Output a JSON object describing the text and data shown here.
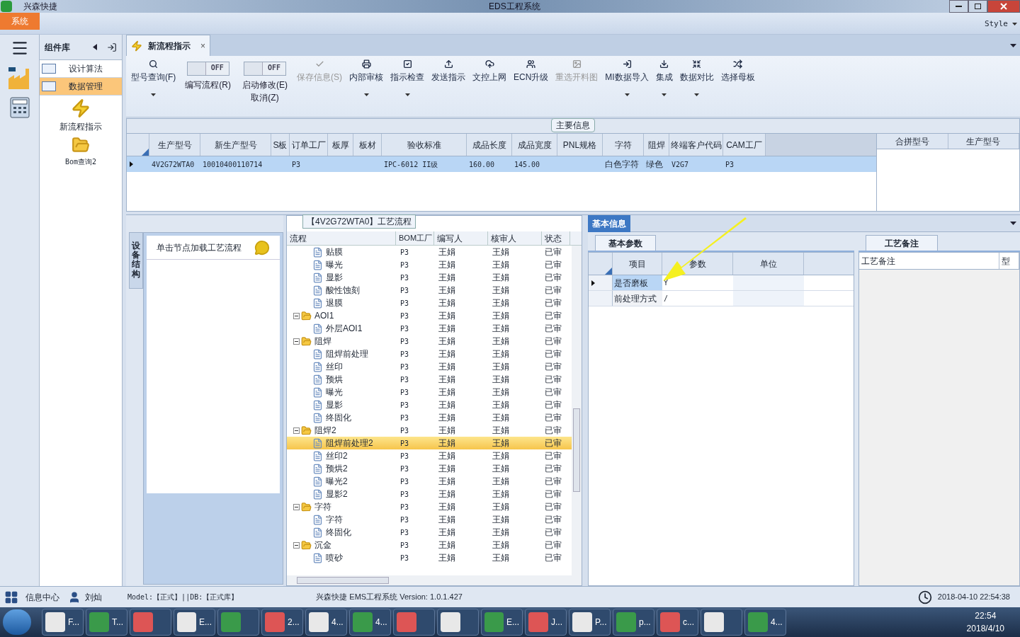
{
  "window": {
    "app_name": "兴森快捷",
    "title": "EDS工程系统"
  },
  "menu": [
    {
      "label": "系统",
      "selected": true
    }
  ],
  "style_menu": "Style",
  "nav": {
    "title": "组件库",
    "items": [
      {
        "label": "设计算法",
        "selected": false
      },
      {
        "label": "数据管理",
        "selected": true
      }
    ],
    "tools": [
      {
        "label": "新流程指示"
      },
      {
        "label": "Bom查询2"
      }
    ]
  },
  "doc_tab": {
    "label": "新流程指示",
    "close": "×"
  },
  "toolbar": [
    {
      "kind": "button",
      "label": "型号查询(F)",
      "disabled": false,
      "dropdown": true
    },
    {
      "kind": "toggle",
      "label": "编写流程(R)",
      "state": "OFF",
      "on": false
    },
    {
      "kind": "toggle",
      "label": "启动修改(E)",
      "sublabel": "取消(Z)",
      "state": "OFF",
      "on": false
    },
    {
      "kind": "button",
      "label": "保存信息(S)",
      "disabled": true,
      "dropdown": false
    },
    {
      "kind": "button",
      "label": "内部审核",
      "disabled": false,
      "dropdown": true
    },
    {
      "kind": "button",
      "label": "指示检查",
      "disabled": false,
      "dropdown": true
    },
    {
      "kind": "button",
      "label": "发送指示",
      "disabled": false,
      "dropdown": false
    },
    {
      "kind": "button",
      "label": "文控上网",
      "disabled": false,
      "dropdown": false
    },
    {
      "kind": "button",
      "label": "ECN升级",
      "disabled": false,
      "dropdown": false
    },
    {
      "kind": "button",
      "label": "重选开料图",
      "disabled": true,
      "dropdown": false
    },
    {
      "kind": "button",
      "label": "MI数据导入",
      "disabled": false,
      "dropdown": true
    },
    {
      "kind": "button",
      "label": "集成",
      "disabled": false,
      "dropdown": true
    },
    {
      "kind": "button",
      "label": "数据对比",
      "disabled": false,
      "dropdown": true
    },
    {
      "kind": "button",
      "label": "选择母板",
      "disabled": false,
      "dropdown": false
    }
  ],
  "main_info": {
    "title": "主要信息",
    "columns": [
      "生产型号",
      "新生产型号",
      "S板",
      "订单工厂",
      "板厚",
      "板材",
      "验收标准",
      "成品长度",
      "成品宽度",
      "PNL规格",
      "字符",
      "阻焊",
      "终端客户代码",
      "CAM工厂"
    ],
    "rows": [
      {
        "selected": true,
        "cells": [
          "4V2G72WTA0",
          "10010400110714",
          "",
          "P3",
          "",
          "",
          "IPC-6012 II级",
          "160.00",
          "145.00",
          "",
          "白色字符",
          "绿色",
          "V2G7",
          "P3"
        ]
      }
    ],
    "side_columns": [
      "合拼型号",
      "生产型号"
    ]
  },
  "structure": {
    "tab": "设备结构",
    "node_hint": "单击节点加载工艺流程"
  },
  "process": {
    "title": "【4V2G72WTA0】工艺流程",
    "columns": [
      "流程",
      "BOM工厂",
      "编写人",
      "核审人",
      "状态"
    ],
    "rows": [
      {
        "kind": "hidden",
        "children": [
          {
            "kind": "file",
            "label": "贴膜",
            "bom": "P3",
            "writer": "王娟",
            "reviewer": "王娟",
            "status": "已审",
            "selected": false
          },
          {
            "kind": "file",
            "label": "曝光",
            "bom": "P3",
            "writer": "王娟",
            "reviewer": "王娟",
            "status": "已审",
            "selected": false
          },
          {
            "kind": "file",
            "label": "显影",
            "bom": "P3",
            "writer": "王娟",
            "reviewer": "王娟",
            "status": "已审",
            "selected": false
          },
          {
            "kind": "file",
            "label": "酸性蚀刻",
            "bom": "P3",
            "writer": "王娟",
            "reviewer": "王娟",
            "status": "已审",
            "selected": false
          },
          {
            "kind": "file",
            "label": "退膜",
            "bom": "P3",
            "writer": "王娟",
            "reviewer": "王娟",
            "status": "已审",
            "selected": false
          }
        ]
      },
      {
        "kind": "folder",
        "label": "AOI1",
        "bom": "P3",
        "writer": "王娟",
        "reviewer": "王娟",
        "status": "已审",
        "selected": false,
        "expanded": true,
        "children": [
          {
            "kind": "file",
            "label": "外层AOI1",
            "bom": "P3",
            "writer": "王娟",
            "reviewer": "王娟",
            "status": "已审",
            "selected": false
          }
        ]
      },
      {
        "kind": "folder",
        "label": "阻焊",
        "bom": "P3",
        "writer": "王娟",
        "reviewer": "王娟",
        "status": "已审",
        "selected": false,
        "expanded": true,
        "children": [
          {
            "kind": "file",
            "label": "阻焊前处理",
            "bom": "P3",
            "writer": "王娟",
            "reviewer": "王娟",
            "status": "已审",
            "selected": false
          },
          {
            "kind": "file",
            "label": "丝印",
            "bom": "P3",
            "writer": "王娟",
            "reviewer": "王娟",
            "status": "已审",
            "selected": false
          },
          {
            "kind": "file",
            "label": "预烘",
            "bom": "P3",
            "writer": "王娟",
            "reviewer": "王娟",
            "status": "已审",
            "selected": false
          },
          {
            "kind": "file",
            "label": "曝光",
            "bom": "P3",
            "writer": "王娟",
            "reviewer": "王娟",
            "status": "已审",
            "selected": false
          },
          {
            "kind": "file",
            "label": "显影",
            "bom": "P3",
            "writer": "王娟",
            "reviewer": "王娟",
            "status": "已审",
            "selected": false
          },
          {
            "kind": "file",
            "label": "终固化",
            "bom": "P3",
            "writer": "王娟",
            "reviewer": "王娟",
            "status": "已审",
            "selected": false
          }
        ]
      },
      {
        "kind": "folder",
        "label": "阻焊2",
        "bom": "P3",
        "writer": "王娟",
        "reviewer": "王娟",
        "status": "已审",
        "selected": false,
        "expanded": true,
        "children": [
          {
            "kind": "file",
            "label": "阻焊前处理2",
            "bom": "P3",
            "writer": "王娟",
            "reviewer": "王娟",
            "status": "已审",
            "selected": true
          },
          {
            "kind": "file",
            "label": "丝印2",
            "bom": "P3",
            "writer": "王娟",
            "reviewer": "王娟",
            "status": "已审",
            "selected": false
          },
          {
            "kind": "file",
            "label": "预烘2",
            "bom": "P3",
            "writer": "王娟",
            "reviewer": "王娟",
            "status": "已审",
            "selected": false
          },
          {
            "kind": "file",
            "label": "曝光2",
            "bom": "P3",
            "writer": "王娟",
            "reviewer": "王娟",
            "status": "已审",
            "selected": false
          },
          {
            "kind": "file",
            "label": "显影2",
            "bom": "P3",
            "writer": "王娟",
            "reviewer": "王娟",
            "status": "已审",
            "selected": false
          }
        ]
      },
      {
        "kind": "folder",
        "label": "字符",
        "bom": "P3",
        "writer": "王娟",
        "reviewer": "王娟",
        "status": "已审",
        "selected": false,
        "expanded": true,
        "children": [
          {
            "kind": "file",
            "label": "字符",
            "bom": "P3",
            "writer": "王娟",
            "reviewer": "王娟",
            "status": "已审",
            "selected": false
          },
          {
            "kind": "file",
            "label": "终固化",
            "bom": "P3",
            "writer": "王娟",
            "reviewer": "王娟",
            "status": "已审",
            "selected": false
          }
        ]
      },
      {
        "kind": "folder",
        "label": "沉金",
        "bom": "P3",
        "writer": "王娟",
        "reviewer": "王娟",
        "status": "已审",
        "selected": false,
        "expanded": true,
        "children": [
          {
            "kind": "file",
            "label": "喷砂",
            "bom": "P3",
            "writer": "王娟",
            "reviewer": "王娟",
            "status": "已审",
            "selected": false
          }
        ]
      }
    ]
  },
  "basic_info": {
    "tab": "基本信息",
    "params_tab": "基本参数",
    "columns": [
      "项目",
      "参数",
      "单位"
    ],
    "rows": [
      {
        "item": "是否磨板",
        "value": "Y",
        "current": true
      },
      {
        "item": "前处理方式",
        "value": "/",
        "current": false
      }
    ],
    "notes_tab": "工艺备注",
    "notes_columns": [
      "工艺备注",
      "型"
    ]
  },
  "status_bar": {
    "info_center": "信息中心",
    "user": "刘灿",
    "model": "Model:【正式】||DB:【正式库】",
    "version": "兴森快捷 EMS工程系统 Version: 1.0.1.427",
    "datetime": "2018-04-10 22:54:38"
  },
  "taskbar": {
    "items": [
      {
        "kind": "app",
        "label": "F..."
      },
      {
        "kind": "app",
        "label": "T..."
      },
      {
        "kind": "app"
      },
      {
        "kind": "app",
        "label": "E..."
      },
      {
        "kind": "app"
      },
      {
        "kind": "app",
        "label": "2..."
      },
      {
        "kind": "app",
        "label": "4..."
      },
      {
        "kind": "app",
        "label": "4..."
      },
      {
        "kind": "app"
      },
      {
        "kind": "app"
      },
      {
        "kind": "app",
        "label": "E..."
      },
      {
        "kind": "app",
        "label": "J..."
      },
      {
        "kind": "app",
        "label": "P..."
      },
      {
        "kind": "app",
        "label": "p..."
      },
      {
        "kind": "app",
        "label": "c..."
      },
      {
        "kind": "app"
      },
      {
        "kind": "app",
        "label": "4..."
      }
    ],
    "time": "22:54",
    "date": "2018/4/10"
  }
}
